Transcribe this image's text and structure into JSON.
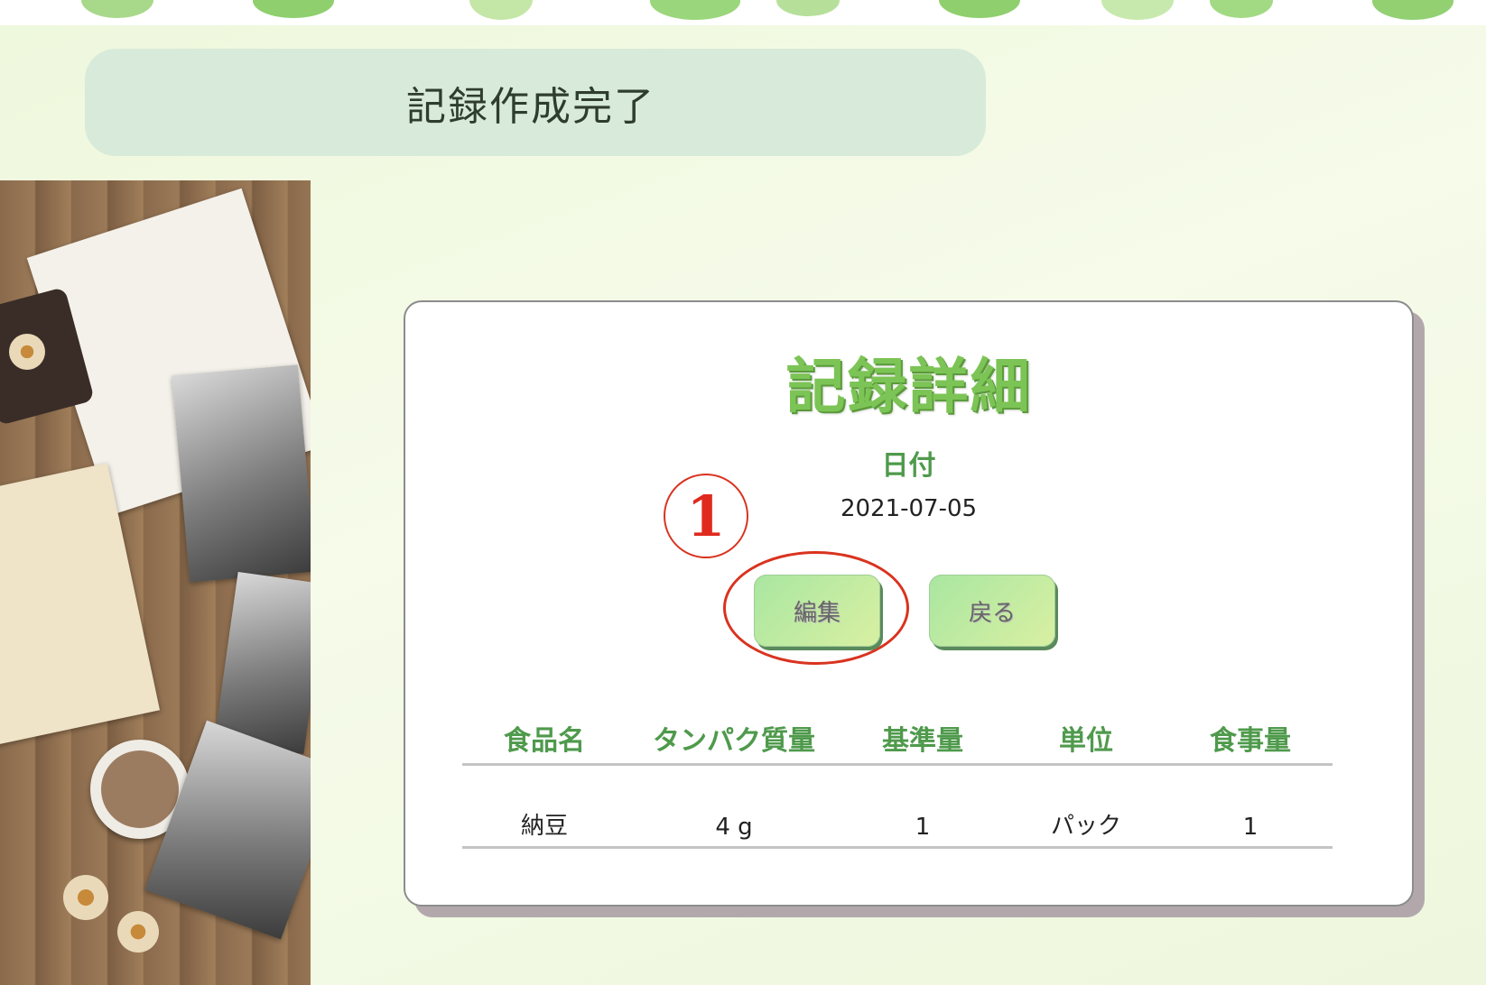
{
  "notice": {
    "text": "記録作成完了"
  },
  "detail": {
    "title": "記録詳細",
    "date_label": "日付",
    "date_value": "2021-07-05",
    "annotation_number": "1",
    "buttons": {
      "edit": "編集",
      "back": "戻る"
    },
    "table": {
      "headers": [
        "食品名",
        "タンパク質量",
        "基準量",
        "単位",
        "食事量"
      ],
      "rows": [
        [
          "納豆",
          "4 g",
          "1",
          "パック",
          "1"
        ]
      ]
    }
  },
  "colors": {
    "accent_green": "#7cc456",
    "label_green": "#4f9a4c",
    "notice_bg": "#d8ead9",
    "annotation_red": "#d9331f"
  }
}
